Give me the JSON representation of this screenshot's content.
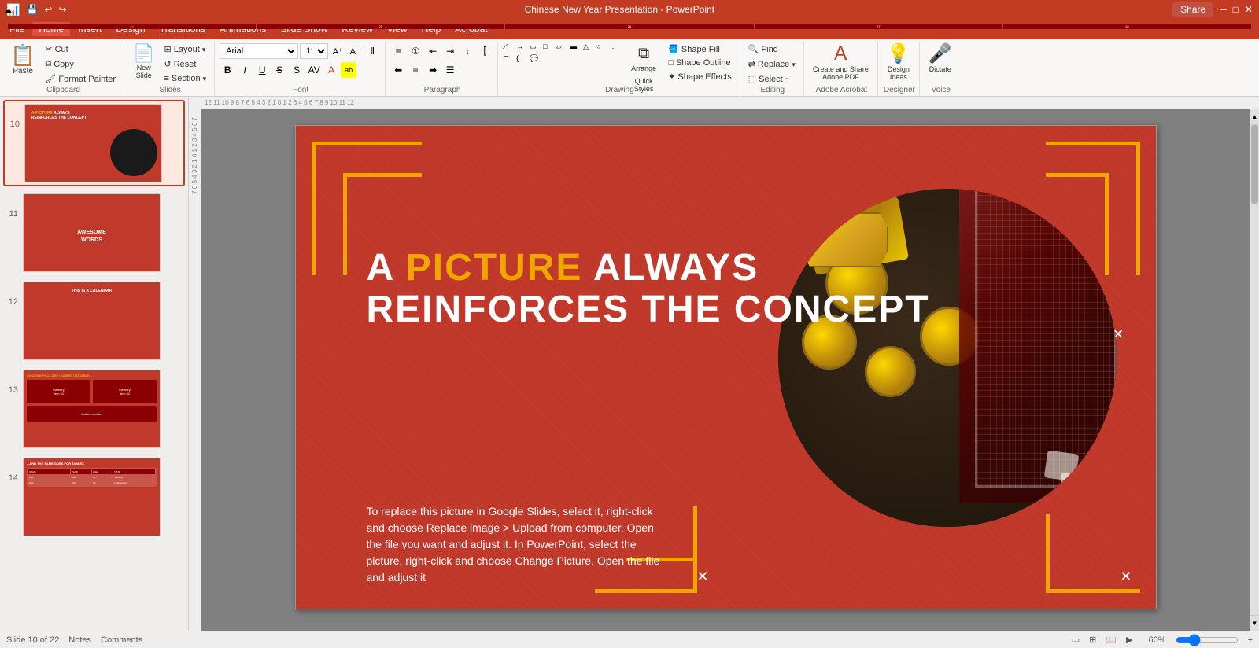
{
  "app": {
    "title": "Chinese New Year Presentation - PowerPoint",
    "share_label": "Share"
  },
  "menu": {
    "items": [
      "File",
      "Home",
      "Insert",
      "Design",
      "Transitions",
      "Animations",
      "Slide Show",
      "Review",
      "View",
      "Help",
      "Acrobat"
    ]
  },
  "ribbon": {
    "active_tab": "Home",
    "groups": {
      "clipboard": {
        "label": "Clipboard",
        "buttons": [
          "Paste",
          "Cut",
          "Copy",
          "Format Painter"
        ]
      },
      "slides": {
        "label": "Slides",
        "buttons": [
          "New Slide",
          "Layout",
          "Reset",
          "Section"
        ]
      },
      "font": {
        "label": "Font",
        "font_name": "Arial",
        "font_size": "11",
        "bold": "B",
        "italic": "I",
        "underline": "U",
        "strikethrough": "S",
        "shadow": "S",
        "font_color": "A"
      },
      "paragraph": {
        "label": "Paragraph"
      },
      "drawing": {
        "label": "Drawing",
        "shape_fill": "Shape Fill",
        "shape_outline": "Shape Outline",
        "shape_effects": "Shape Effects"
      },
      "editing": {
        "label": "Editing",
        "find": "Find",
        "replace": "Replace",
        "select": "Select"
      },
      "adobe_acrobat": {
        "label": "Adobe Acrobat",
        "create_share": "Create and Share Adobe PDF"
      },
      "designer": {
        "label": "Designer",
        "design_ideas": "Design Ideas"
      },
      "voice": {
        "label": "Voice",
        "dictate": "Dictate"
      }
    }
  },
  "slides": [
    {
      "num": "10",
      "type": "picture",
      "title": "A PICTURE ALWAYS REINFORCES THE CONCEPT"
    },
    {
      "num": "11",
      "type": "words",
      "title": "AWESOME WORDS"
    },
    {
      "num": "12",
      "type": "calendar",
      "title": "THIS IS A CALENDAR"
    },
    {
      "num": "13",
      "type": "infographic",
      "title": "INFOGRAPHICS ARE UNDERSTANDABLE..."
    },
    {
      "num": "14",
      "type": "table",
      "title": "...AND THE SAME GOES FOR TABLES"
    }
  ],
  "main_slide": {
    "title_part1": "A ",
    "title_highlight": "PICTURE",
    "title_part2": " ALWAYS",
    "title_line2": "REINFORCES THE CONCEPT",
    "body_text": "To replace this picture in Google Slides, select it, right-click and choose Replace image > Upload from computer. Open the file you want and adjust it. In PowerPoint, select the picture, right-click and choose Change Picture. Open the file and adjust it"
  },
  "status_bar": {
    "slide_count": "Slide 10 of 22",
    "notes": "Notes",
    "comments": "Comments",
    "zoom": "60%"
  },
  "section_label": "Section",
  "shape_effects_label": "Shape Effects",
  "select_label": "Select ~"
}
